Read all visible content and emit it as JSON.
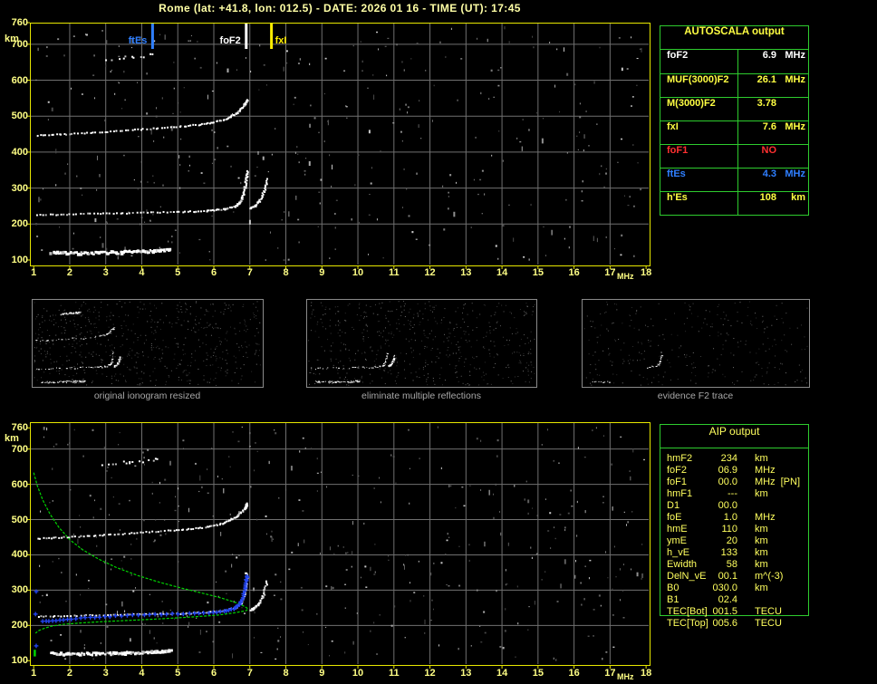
{
  "title": "Rome (lat: +41.8, lon: 012.5) - DATE: 2026 01 16 - TIME (UT): 17:45",
  "colors": {
    "background": "#000000",
    "title_text": "#ffffa6",
    "axis_text": "#ffff85",
    "plot_border": "#e8e800",
    "grid": "#707070",
    "table_border": "#2ecc2e",
    "table_yellow": "#ffff42",
    "white": "#ffffff",
    "red": "#ff3030",
    "blue": "#2f7fff",
    "profile_green": "#00d400",
    "restored_trace_blue": "#2244ee",
    "caption_gray": "#a8a8a8",
    "thumb_border": "#8a8a8a"
  },
  "autoscala_table": {
    "header": "AUTOSCALA output",
    "rows": [
      {
        "param": "foF2",
        "value": "6.9",
        "unit": "MHz",
        "color": "white"
      },
      {
        "param": "MUF(3000)F2",
        "value": "26.1",
        "unit": "MHz",
        "color": "yellow"
      },
      {
        "param": "M(3000)F2",
        "value": "3.78",
        "unit": "",
        "color": "yellow"
      },
      {
        "param": "fxI",
        "value": "7.6",
        "unit": "MHz",
        "color": "yellow"
      },
      {
        "param": "foF1",
        "value": "NO",
        "unit": "",
        "color": "red"
      },
      {
        "param": "ftEs",
        "value": "4.3",
        "unit": "MHz",
        "color": "blue"
      },
      {
        "param": "h'Es",
        "value": "108",
        "unit": "km",
        "color": "yellow"
      }
    ]
  },
  "aip_table": {
    "header": "AIP output",
    "rows": [
      {
        "param": "hmF2",
        "value": "234",
        "unit": "km",
        "note": ""
      },
      {
        "param": "foF2",
        "value": "06.9",
        "unit": "MHz",
        "note": ""
      },
      {
        "param": "foF1",
        "value": "00.0",
        "unit": "MHz",
        "note": "[PN]"
      },
      {
        "param": "hmF1",
        "value": "---",
        "unit": "km",
        "note": ""
      },
      {
        "param": "D1",
        "value": "00.0",
        "unit": "",
        "note": ""
      },
      {
        "param": "foE",
        "value": "1.0",
        "unit": "MHz",
        "note": ""
      },
      {
        "param": "hmE",
        "value": "110",
        "unit": "km",
        "note": ""
      },
      {
        "param": "ymE",
        "value": "20",
        "unit": "km",
        "note": ""
      },
      {
        "param": "h_vE",
        "value": "133",
        "unit": "km",
        "note": ""
      },
      {
        "param": "Ewidth",
        "value": "58",
        "unit": "km",
        "note": ""
      },
      {
        "param": "DelN_vE",
        "value": "00.1",
        "unit": "m^(-3)",
        "note": ""
      },
      {
        "param": "B0",
        "value": "030.0",
        "unit": "km",
        "note": ""
      },
      {
        "param": "B1",
        "value": "02.4",
        "unit": "",
        "note": ""
      },
      {
        "param": "TEC[Bot]",
        "value": "001.5",
        "unit": "TECU",
        "note": ""
      },
      {
        "param": "TEC[Top]",
        "value": "005.6",
        "unit": "TECU",
        "note": ""
      }
    ]
  },
  "thumbnails": [
    {
      "caption": "original ionogram resized",
      "traces": [
        "Es",
        "Fo",
        "Fx",
        "hop2",
        "spread"
      ],
      "noise": 620
    },
    {
      "caption": "eliminate multiple reflections",
      "traces": [
        "Es",
        "Fo",
        "Fx"
      ],
      "noise": 540
    },
    {
      "caption": "evidence F2 trace",
      "traces": [
        "Fcusp",
        "EsBits"
      ],
      "noise": 300
    }
  ],
  "chart_data": [
    {
      "id": "scaled-ionogram",
      "type": "scatter",
      "title": "scaled ionogram with autoscaled characteristics",
      "xlabel": "MHz",
      "ylabel": "km",
      "xlim": [
        1,
        18
      ],
      "ylim": [
        100,
        760
      ],
      "xticks": [
        1,
        2,
        3,
        4,
        5,
        6,
        7,
        8,
        9,
        10,
        11,
        12,
        13,
        14,
        15,
        16,
        17,
        18
      ],
      "yticks": [
        760,
        700,
        600,
        500,
        400,
        300,
        200,
        100
      ],
      "x_unit": "MHz",
      "y_unit": "km",
      "grid": true,
      "markers": [
        {
          "label": "ftEs",
          "f": 4.3,
          "color": "#2f7fff",
          "align": "right"
        },
        {
          "label": "foF2",
          "f": 6.9,
          "color": "#ffffff",
          "align": "right"
        },
        {
          "label": "fxI",
          "f": 7.6,
          "color": "#ffee00",
          "align": "left"
        }
      ],
      "series": [
        {
          "key": "Es",
          "name": "Es-layer-echo",
          "points": [
            [
              1.5,
              121
            ],
            [
              2.1,
              118
            ],
            [
              2.7,
              119
            ],
            [
              3.3,
              120
            ],
            [
              3.9,
              122
            ],
            [
              4.4,
              125
            ],
            [
              4.8,
              127
            ]
          ]
        },
        {
          "key": "Fo",
          "name": "F-layer-echo-ordinary",
          "points": [
            [
              1.12,
              225
            ],
            [
              2.0,
              227
            ],
            [
              3.0,
              229
            ],
            [
              4.0,
              231
            ],
            [
              5.0,
              233
            ],
            [
              5.8,
              236
            ],
            [
              6.3,
              241
            ],
            [
              6.6,
              249
            ],
            [
              6.75,
              262
            ],
            [
              6.85,
              288
            ],
            [
              6.9,
              320
            ],
            [
              6.93,
              348
            ]
          ]
        },
        {
          "key": "Fx",
          "name": "F-layer-echo-extraordinary",
          "points": [
            [
              7.02,
              242
            ],
            [
              7.15,
              250
            ],
            [
              7.28,
              264
            ],
            [
              7.4,
              290
            ],
            [
              7.48,
              324
            ]
          ]
        },
        {
          "key": "hop2",
          "name": "F-layer-second-hop-echo",
          "points": [
            [
              1.12,
              446
            ],
            [
              2.0,
              450
            ],
            [
              3.0,
              456
            ],
            [
              4.0,
              463
            ],
            [
              5.0,
              470
            ],
            [
              5.8,
              478
            ],
            [
              6.3,
              490
            ],
            [
              6.65,
              508
            ],
            [
              6.85,
              530
            ],
            [
              6.95,
              545
            ]
          ]
        },
        {
          "key": "spread",
          "name": "spread-echo-dots",
          "points": [
            [
              2.95,
              657
            ],
            [
              3.4,
              661
            ],
            [
              3.9,
              665
            ],
            [
              4.45,
              671
            ]
          ]
        }
      ],
      "noise": {
        "seed": 42,
        "count": 380
      }
    },
    {
      "id": "profile-ionogram",
      "type": "scatter",
      "title": "ionogram with restored trace and electron density profile",
      "xlabel": "MHz",
      "ylabel": "km",
      "xlim": [
        1,
        18
      ],
      "ylim": [
        100,
        760
      ],
      "xticks": [
        1,
        2,
        3,
        4,
        5,
        6,
        7,
        8,
        9,
        10,
        11,
        12,
        13,
        14,
        15,
        16,
        17,
        18
      ],
      "yticks": [
        760,
        700,
        600,
        500,
        400,
        300,
        200,
        100
      ],
      "x_unit": "MHz",
      "y_unit": "km",
      "grid": true,
      "echo_series": "same-as-chart-0",
      "profile_series": {
        "name": "electron-density-profile",
        "color": "#00d400",
        "points": [
          [
            1.0,
            633
          ],
          [
            1.1,
            596
          ],
          [
            1.25,
            556
          ],
          [
            1.45,
            516
          ],
          [
            1.7,
            478
          ],
          [
            2.0,
            443
          ],
          [
            2.35,
            415
          ],
          [
            2.8,
            388
          ],
          [
            3.3,
            364
          ],
          [
            3.9,
            341
          ],
          [
            4.5,
            322
          ],
          [
            5.1,
            306
          ],
          [
            5.7,
            291
          ],
          [
            6.2,
            278
          ],
          [
            6.6,
            265
          ],
          [
            6.85,
            254
          ],
          [
            6.95,
            247
          ],
          [
            6.9,
            242
          ],
          [
            6.6,
            236
          ],
          [
            6.1,
            229
          ],
          [
            5.4,
            224
          ],
          [
            4.6,
            219
          ],
          [
            3.8,
            215
          ],
          [
            3.0,
            211
          ],
          [
            2.3,
            207
          ],
          [
            1.8,
            203
          ],
          [
            1.5,
            198
          ],
          [
            1.3,
            192
          ],
          [
            1.15,
            186
          ],
          [
            1.05,
            178
          ]
        ],
        "bottom_segment": [
          [
            1.03,
            112
          ],
          [
            1.03,
            131
          ]
        ]
      },
      "restored_trace": {
        "name": "restored-F-trace",
        "color": "#2244ee",
        "points": [
          [
            1.25,
            211
          ],
          [
            1.6,
            214
          ],
          [
            2.0,
            218
          ],
          [
            2.5,
            222
          ],
          [
            3.0,
            225
          ],
          [
            3.6,
            228
          ],
          [
            4.2,
            230
          ],
          [
            4.8,
            232
          ],
          [
            5.4,
            234
          ],
          [
            5.9,
            236
          ],
          [
            6.3,
            240
          ],
          [
            6.55,
            247
          ],
          [
            6.7,
            257
          ],
          [
            6.8,
            275
          ],
          [
            6.86,
            300
          ],
          [
            6.9,
            322
          ],
          [
            6.92,
            340
          ]
        ],
        "isolated_points": [
          [
            1.07,
            296
          ],
          [
            1.05,
            232
          ],
          [
            1.07,
            142
          ]
        ]
      },
      "noise": {
        "seed": 97,
        "count": 420
      }
    }
  ]
}
